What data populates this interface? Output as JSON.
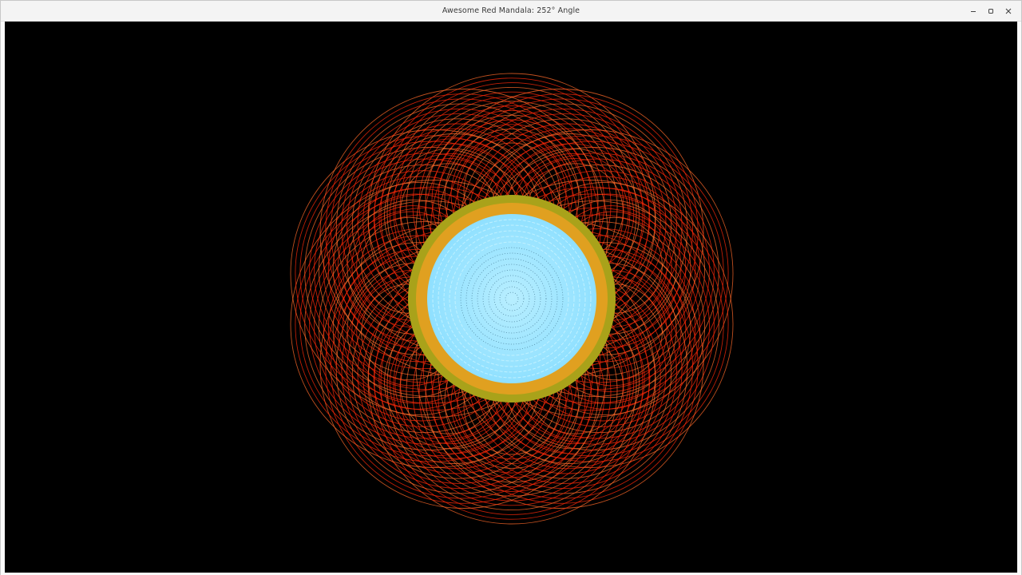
{
  "window": {
    "title": "Awesome Red Mandala: 252° Angle",
    "controls": {
      "minimize_icon": "minimize-icon",
      "maximize_icon": "maximize-icon",
      "close_icon": "close-icon"
    }
  },
  "canvas": {
    "background": "#000000",
    "colors": {
      "petal_red": "#ff2a0a",
      "petal_orange": "#ff6a2a",
      "ring_olive": "#a9a21a",
      "ring_gold": "#e0a020",
      "center_light_blue": "#9ee6ff",
      "center_dot": "#3a6f8a"
    }
  }
}
